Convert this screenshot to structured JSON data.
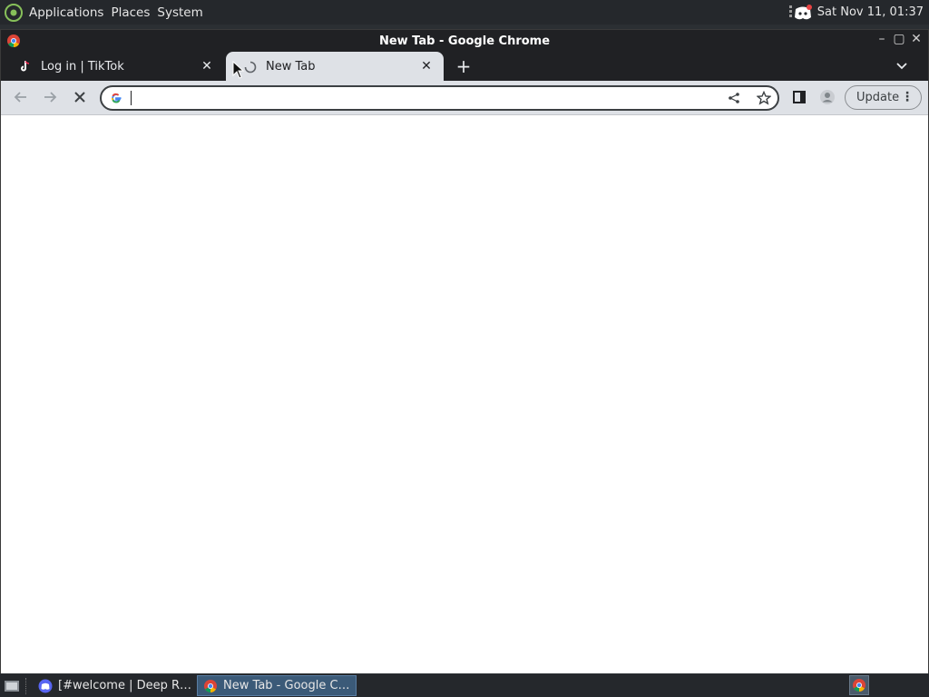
{
  "top_panel": {
    "menus": [
      "Applications",
      "Places",
      "System"
    ],
    "clock": "Sat Nov 11, 01:37"
  },
  "window": {
    "title": "New Tab - Google Chrome"
  },
  "tabs": [
    {
      "label": "Log in | TikTok",
      "active": false
    },
    {
      "label": "New Tab",
      "active": true
    }
  ],
  "toolbar": {
    "omnibox_value": "",
    "update_label": "Update"
  },
  "taskbar": {
    "items": [
      {
        "label": "[#welcome | Deep R…",
        "active": false
      },
      {
        "label": "New Tab - Google C…",
        "active": true
      }
    ]
  },
  "colors": {
    "panel_bg": "#25282c",
    "titlebar_bg": "#202124",
    "toolbar_bg": "#dee1e6",
    "task_active": "#3b5a78"
  }
}
